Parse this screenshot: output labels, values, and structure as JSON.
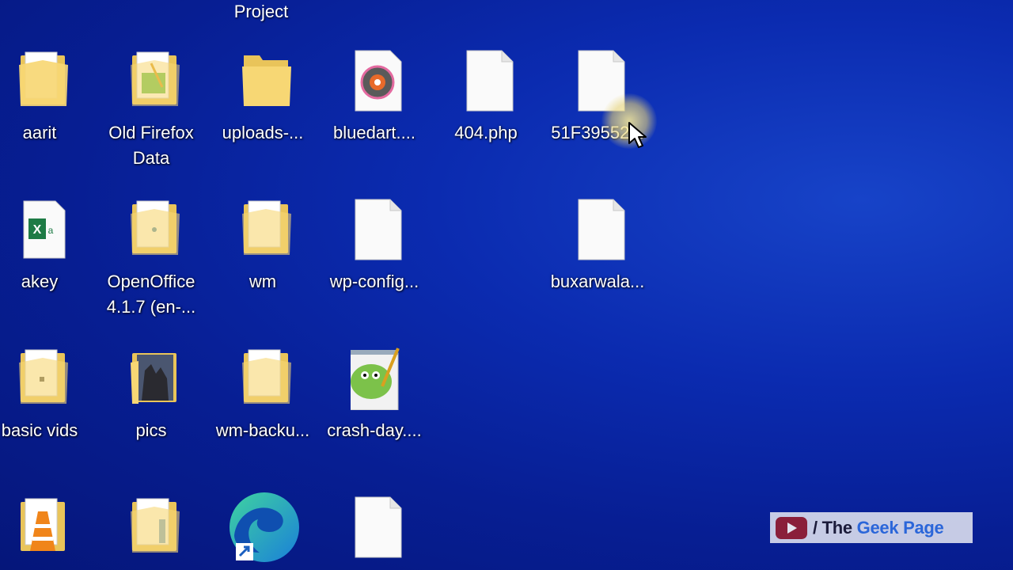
{
  "desktop": {
    "top_partial_label": "Project",
    "icons": [
      {
        "label": "aarit",
        "type": "folder-docs"
      },
      {
        "label": "Old Firefox\nData",
        "type": "folder-green"
      },
      {
        "label": "uploads-...",
        "type": "folder-empty"
      },
      {
        "label": "bluedart....",
        "type": "media-file"
      },
      {
        "label": "404.php",
        "type": "blank-file"
      },
      {
        "label": "51F39552...",
        "type": "blank-file"
      },
      {
        "label": "akey",
        "type": "excel-file"
      },
      {
        "label": "OpenOffice\n4.1.7 (en-...",
        "type": "folder-docs"
      },
      {
        "label": "wm",
        "type": "folder-docs"
      },
      {
        "label": "wp-config...",
        "type": "blank-file"
      },
      {
        "label": "buxarwala...",
        "type": "blank-file"
      },
      {
        "label": "basic vids",
        "type": "folder-docs"
      },
      {
        "label": "pics",
        "type": "folder-photo"
      },
      {
        "label": "wm-backu...",
        "type": "folder-docs"
      },
      {
        "label": "crash-day....",
        "type": "notepadpp-file"
      },
      {
        "label": "",
        "type": "vlc-folder"
      },
      {
        "label": "",
        "type": "folder-docs"
      },
      {
        "label": "",
        "type": "edge-shortcut"
      },
      {
        "label": "",
        "type": "blank-file"
      }
    ]
  },
  "watermark": {
    "slash": "/",
    "the": "The ",
    "geek": "Geek ",
    "page": "Page"
  },
  "colors": {
    "desktop_bg": "#0b2bb0",
    "folder": "#f7d774",
    "watermark_accent": "#2b66d9",
    "youtube_red": "#8a1f3a"
  }
}
